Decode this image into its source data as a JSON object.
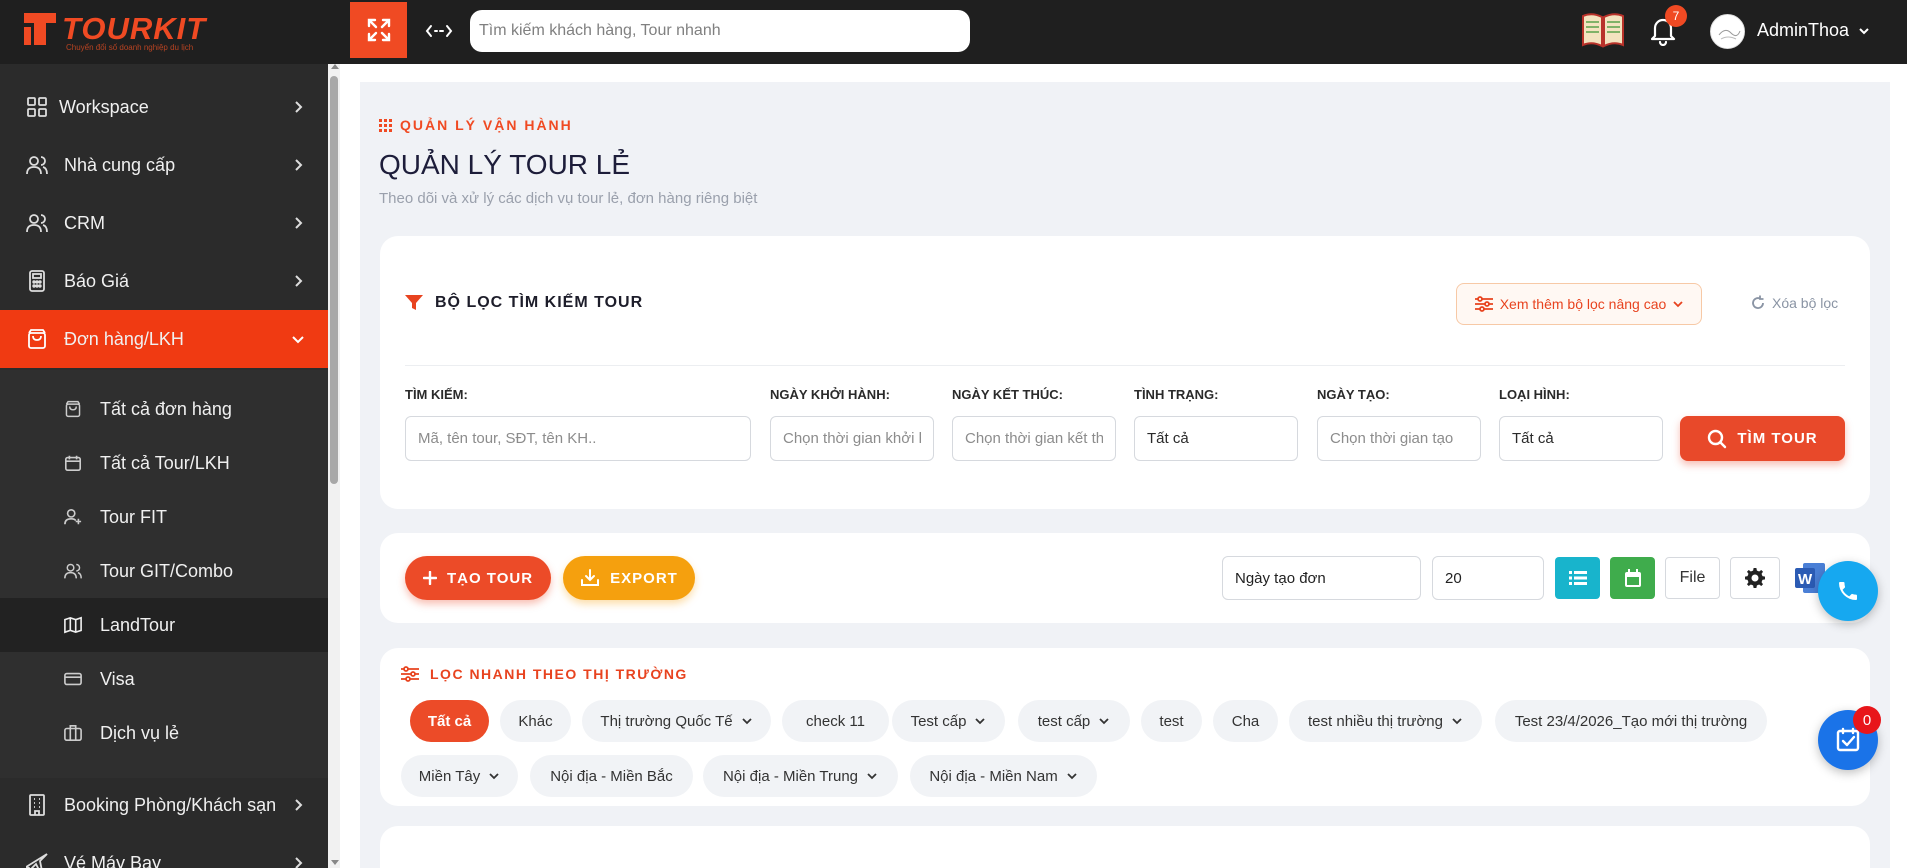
{
  "header": {
    "logo_text": "TOURKIT",
    "logo_tagline": "Chuyển đổi số doanh nghiệp du lịch",
    "search_placeholder": "Tìm kiếm khách hàng, Tour nhanh",
    "notification_count": "7",
    "username": "AdminThoa"
  },
  "sidebar": {
    "items": [
      {
        "label": "Workspace",
        "icon": "grid-icon"
      },
      {
        "label": "Nhà cung cấp",
        "icon": "users-icon"
      },
      {
        "label": "CRM",
        "icon": "users-icon"
      },
      {
        "label": "Báo Giá",
        "icon": "calculator-icon"
      },
      {
        "label": "Đơn hàng/LKH",
        "icon": "shopping-bag-icon",
        "active": true
      }
    ],
    "subitems": [
      {
        "label": "Tất cả đơn hàng",
        "icon": "shopping-bag-icon"
      },
      {
        "label": "Tất cả Tour/LKH",
        "icon": "calendar-icon"
      },
      {
        "label": "Tour FIT",
        "icon": "user-plus-icon"
      },
      {
        "label": "Tour GIT/Combo",
        "icon": "users-icon"
      },
      {
        "label": "LandTour",
        "icon": "map-icon",
        "current": true
      },
      {
        "label": "Visa",
        "icon": "credit-card-icon"
      },
      {
        "label": "Dịch vụ lẻ",
        "icon": "briefcase-icon"
      }
    ],
    "bottom_items": [
      {
        "label": "Booking Phòng/Khách sạn",
        "icon": "building-icon"
      },
      {
        "label": "Vé Máy Bay",
        "icon": "plane-icon"
      }
    ]
  },
  "page": {
    "breadcrumb": "QUẢN LÝ VẬN HÀNH",
    "title": "QUẢN LÝ TOUR LẺ",
    "subtitle": "Theo dõi và xử lý các dịch vụ tour lẻ, đơn hàng riêng biệt"
  },
  "filter": {
    "heading": "BỘ LỌC TÌM KIẾM TOUR",
    "advanced_label": "Xem thêm bộ lọc nâng cao",
    "clear_label": "Xóa bộ lọc",
    "fields": {
      "search": {
        "label": "TÌM KIẾM:",
        "placeholder": "Mã, tên tour, SĐT, tên KH.."
      },
      "start_date": {
        "label": "NGÀY KHỞI HÀNH:",
        "placeholder": "Chọn thời gian khởi hành"
      },
      "end_date": {
        "label": "NGÀY KẾT THÚC:",
        "placeholder": "Chọn thời gian kết thúc"
      },
      "status": {
        "label": "TÌNH TRẠNG:",
        "value": "Tất cả"
      },
      "created_date": {
        "label": "NGÀY TẠO:",
        "placeholder": "Chọn thời gian tạo"
      },
      "type": {
        "label": "LOẠI HÌNH:",
        "value": "Tất cả"
      }
    },
    "search_button": "TÌM TOUR"
  },
  "toolbar": {
    "create_label": "TẠO TOUR",
    "export_label": "EXPORT",
    "sort_value": "Ngày tạo đơn",
    "page_size": "20",
    "file_label": "File"
  },
  "quick_filter": {
    "heading": "LỌC NHANH THEO THỊ TRƯỜNG",
    "chips": [
      {
        "label": "Tất cả",
        "active": true
      },
      {
        "label": "Khác"
      },
      {
        "label": "Thị trường Quốc Tế",
        "dropdown": true
      },
      {
        "label": "check 11"
      },
      {
        "label": "Test cấp",
        "dropdown": true
      },
      {
        "label": "test cấp",
        "dropdown": true
      },
      {
        "label": "test"
      },
      {
        "label": "Cha"
      },
      {
        "label": "test nhiều thị trường",
        "dropdown": true
      },
      {
        "label": "Test 23/4/2026_Tạo mới thị trường"
      },
      {
        "label": "Miền Tây",
        "dropdown": true
      },
      {
        "label": "Nội địa - Miền Bắc"
      },
      {
        "label": "Nội địa - Miền Trung",
        "dropdown": true
      },
      {
        "label": "Nội địa - Miền Nam",
        "dropdown": true
      }
    ]
  },
  "floating": {
    "task_count": "0"
  },
  "colors": {
    "brand": "#f04a23",
    "sidebar_bg": "#2b2b2b",
    "active_menu": "#f03a12",
    "export": "#f5a00e",
    "list_view": "#18b4cc",
    "calendar_view": "#3fac4c",
    "phone_fab": "#16a8f0",
    "task_fab": "#1a73e8"
  }
}
